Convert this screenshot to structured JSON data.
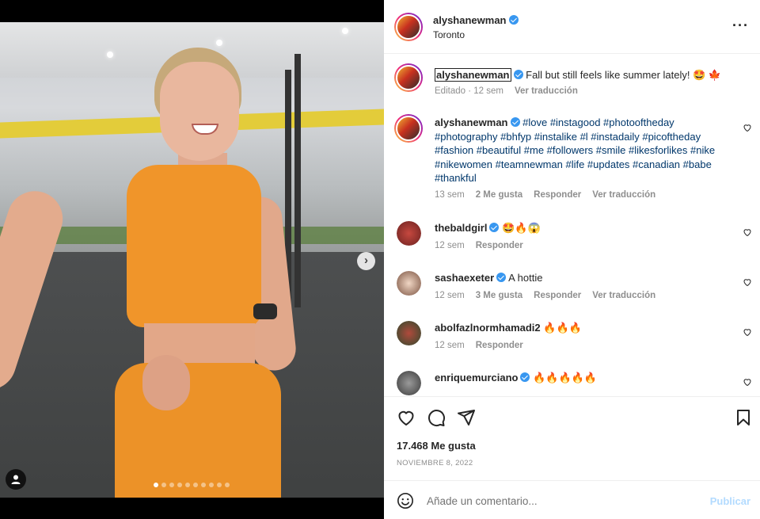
{
  "post": {
    "author": "alyshanewman",
    "location": "Toronto",
    "caption": {
      "author": "alyshanewman",
      "text": "Fall but still feels like summer lately! 🤩 🍁",
      "status": "Editado",
      "time": "12 sem",
      "translate": "Ver traducción"
    },
    "likes": "17.468 Me gusta",
    "date": "NOVIEMBRE 8, 2022",
    "carousel_count": 10,
    "carousel_active": 1
  },
  "comments": [
    {
      "author": "alyshanewman",
      "verified": true,
      "text": "#love #instagood #photooftheday #photography #bhfyp #instalike #l #instadaily #picoftheday #fashion #beautiful #me #followers #smile #likesforlikes #nike #nikewomen #teamnewman #life #updates #canadian #babe #thankful",
      "time": "13 sem",
      "likes": "2 Me gusta",
      "reply": "Responder",
      "translate": "Ver traducción"
    },
    {
      "author": "thebaldgirl",
      "verified": true,
      "text": "🤩🔥😱",
      "time": "12 sem",
      "likes": "",
      "reply": "Responder",
      "translate": ""
    },
    {
      "author": "sashaexeter",
      "verified": true,
      "text": "A hottie",
      "time": "12 sem",
      "likes": "3 Me gusta",
      "reply": "Responder",
      "translate": "Ver traducción"
    },
    {
      "author": "abolfazlnormhamadi2",
      "verified": false,
      "text": "🔥🔥🔥",
      "time": "12 sem",
      "likes": "",
      "reply": "Responder",
      "translate": ""
    },
    {
      "author": "enriquemurciano",
      "verified": true,
      "text": "🔥🔥🔥🔥🔥",
      "time": "",
      "likes": "",
      "reply": "",
      "translate": ""
    }
  ],
  "composer": {
    "placeholder": "Añade un comentario...",
    "publish_label": "Publicar"
  },
  "icons": {
    "more": "more-options-icon",
    "like": "heart-icon",
    "comment": "comment-icon",
    "share": "send-icon",
    "save": "bookmark-icon",
    "emoji": "emoji-icon",
    "next": "chevron-right-icon",
    "tag": "user-tag-icon"
  },
  "colors": {
    "link": "#00376b",
    "verified": "#3897f0",
    "muted": "#8e8e8e",
    "publish_disabled": "#b3dbff"
  }
}
